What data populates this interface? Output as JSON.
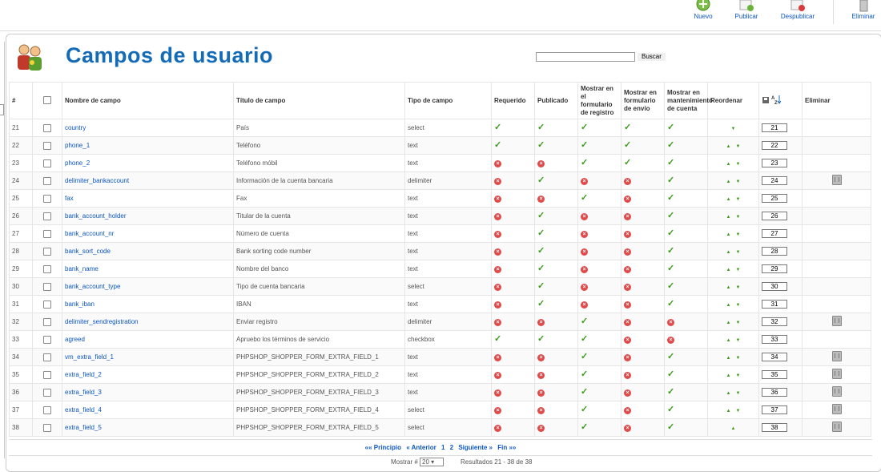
{
  "toolbar": {
    "nuevo": "Nuevo",
    "publicar": "Publicar",
    "despublicar": "Despublicar",
    "eliminar": "Eliminar"
  },
  "page": {
    "title": "Campos de usuario"
  },
  "search": {
    "value": "",
    "button": "Buscar"
  },
  "table": {
    "headers": {
      "num": "#",
      "nombre": "Nombre de campo",
      "titulo": "Título de campo",
      "tipo": "Tipo de campo",
      "requerido": "Requerido",
      "publicado": "Publicado",
      "registro": "Mostrar en el formulario de registro",
      "envio": "Mostrar en formulario de envío",
      "mant": "Mostrar en mantenimiento de cuenta",
      "reordenar": "Reordenar",
      "eliminar": "Eliminar"
    },
    "rows": [
      {
        "id": "21",
        "name": "country",
        "title": "País",
        "type": "select",
        "req": true,
        "pub": true,
        "reg": true,
        "env": true,
        "mant": true,
        "up": false,
        "down": true,
        "order": "21",
        "del": false
      },
      {
        "id": "22",
        "name": "phone_1",
        "title": "Teléfono",
        "type": "text",
        "req": true,
        "pub": true,
        "reg": true,
        "env": true,
        "mant": true,
        "up": true,
        "down": true,
        "order": "22",
        "del": false
      },
      {
        "id": "23",
        "name": "phone_2",
        "title": "Teléfono móbil",
        "type": "text",
        "req": false,
        "pub": false,
        "reg": true,
        "env": true,
        "mant": true,
        "up": true,
        "down": true,
        "order": "23",
        "del": false
      },
      {
        "id": "24",
        "name": "delimiter_bankaccount",
        "title": "Información de la cuenta bancaria",
        "type": "delimiter",
        "req": false,
        "pub": true,
        "reg": false,
        "env": false,
        "mant": true,
        "up": true,
        "down": true,
        "order": "24",
        "del": true
      },
      {
        "id": "25",
        "name": "fax",
        "title": "Fax",
        "type": "text",
        "req": false,
        "pub": false,
        "reg": true,
        "env": false,
        "mant": true,
        "up": true,
        "down": true,
        "order": "25",
        "del": false
      },
      {
        "id": "26",
        "name": "bank_account_holder",
        "title": "Titular de la cuenta",
        "type": "text",
        "req": false,
        "pub": true,
        "reg": false,
        "env": false,
        "mant": true,
        "up": true,
        "down": true,
        "order": "26",
        "del": false
      },
      {
        "id": "27",
        "name": "bank_account_nr",
        "title": "Número de cuenta",
        "type": "text",
        "req": false,
        "pub": true,
        "reg": false,
        "env": false,
        "mant": true,
        "up": true,
        "down": true,
        "order": "27",
        "del": false
      },
      {
        "id": "28",
        "name": "bank_sort_code",
        "title": "Bank sorting code number",
        "type": "text",
        "req": false,
        "pub": true,
        "reg": false,
        "env": false,
        "mant": true,
        "up": true,
        "down": true,
        "order": "28",
        "del": false
      },
      {
        "id": "29",
        "name": "bank_name",
        "title": "Nombre del banco",
        "type": "text",
        "req": false,
        "pub": true,
        "reg": false,
        "env": false,
        "mant": true,
        "up": true,
        "down": true,
        "order": "29",
        "del": false
      },
      {
        "id": "30",
        "name": "bank_account_type",
        "title": "Tipo de cuenta bancaria",
        "type": "select",
        "req": false,
        "pub": true,
        "reg": false,
        "env": false,
        "mant": true,
        "up": true,
        "down": true,
        "order": "30",
        "del": false
      },
      {
        "id": "31",
        "name": "bank_iban",
        "title": "IBAN",
        "type": "text",
        "req": false,
        "pub": true,
        "reg": false,
        "env": false,
        "mant": true,
        "up": true,
        "down": true,
        "order": "31",
        "del": false
      },
      {
        "id": "32",
        "name": "delimiter_sendregistration",
        "title": "Enviar registro",
        "type": "delimiter",
        "req": false,
        "pub": false,
        "reg": true,
        "env": false,
        "mant": false,
        "up": true,
        "down": true,
        "order": "32",
        "del": true
      },
      {
        "id": "33",
        "name": "agreed",
        "title": "Apruebo los términos de servicio",
        "type": "checkbox",
        "req": true,
        "pub": true,
        "reg": true,
        "env": false,
        "mant": false,
        "up": true,
        "down": true,
        "order": "33",
        "del": false
      },
      {
        "id": "34",
        "name": "vm_extra_field_1",
        "title": "PHPSHOP_SHOPPER_FORM_EXTRA_FIELD_1",
        "type": "text",
        "req": false,
        "pub": false,
        "reg": true,
        "env": false,
        "mant": true,
        "up": true,
        "down": true,
        "order": "34",
        "del": true
      },
      {
        "id": "35",
        "name": "extra_field_2",
        "title": "PHPSHOP_SHOPPER_FORM_EXTRA_FIELD_2",
        "type": "text",
        "req": false,
        "pub": false,
        "reg": true,
        "env": false,
        "mant": true,
        "up": true,
        "down": true,
        "order": "35",
        "del": true
      },
      {
        "id": "36",
        "name": "extra_field_3",
        "title": "PHPSHOP_SHOPPER_FORM_EXTRA_FIELD_3",
        "type": "text",
        "req": false,
        "pub": false,
        "reg": true,
        "env": false,
        "mant": true,
        "up": true,
        "down": true,
        "order": "36",
        "del": true
      },
      {
        "id": "37",
        "name": "extra_field_4",
        "title": "PHPSHOP_SHOPPER_FORM_EXTRA_FIELD_4",
        "type": "select",
        "req": false,
        "pub": false,
        "reg": true,
        "env": false,
        "mant": true,
        "up": true,
        "down": true,
        "order": "37",
        "del": true
      },
      {
        "id": "38",
        "name": "extra_field_5",
        "title": "PHPSHOP_SHOPPER_FORM_EXTRA_FIELD_5",
        "type": "select",
        "req": false,
        "pub": false,
        "reg": true,
        "env": false,
        "mant": true,
        "up": true,
        "down": false,
        "order": "38",
        "del": true
      }
    ]
  },
  "pagination": {
    "first": "«« Principio",
    "prev": "« Anterior",
    "p1": "1",
    "p2": "2",
    "next": "Siguiente »",
    "last": "Fin »»"
  },
  "footer": {
    "mostrar_label": "Mostrar #",
    "mostrar_value": "20",
    "results": "Resultados 21 - 38 de 38"
  },
  "colors": {
    "link": "#0b55c4",
    "title": "#146bb8",
    "check": "#3b9a1a",
    "cross": "#e24a4a"
  }
}
